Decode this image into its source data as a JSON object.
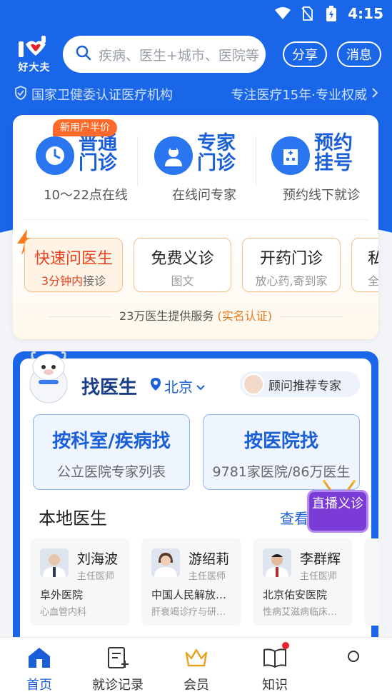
{
  "status": {
    "time": "4:15"
  },
  "header": {
    "logo_text": "好大夫",
    "search_placeholder": "疾病、医生+城市、医院等",
    "share_label": "分享",
    "message_label": "消息"
  },
  "cert": {
    "left": "国家卫健委认证医疗机构",
    "right": "专注医疗15年·专业权威"
  },
  "services": [
    {
      "name": "普通门诊",
      "sub": "10～22点在线",
      "badge": "新用户半价"
    },
    {
      "name": "专家门诊",
      "sub": "在线问专家"
    },
    {
      "name": "预约挂号",
      "sub": "预约线下就诊"
    }
  ],
  "quick": [
    {
      "title": "快速问医生",
      "sub_em": "3分钟内",
      "sub": "接诊"
    },
    {
      "title": "免费义诊",
      "sub": "图文"
    },
    {
      "title": "开药门诊",
      "sub": "放心药,寄到家"
    },
    {
      "title": "私",
      "sub": "全"
    }
  ],
  "footer_note": {
    "text": "23万医生提供服务",
    "highlight": "(实名认证)"
  },
  "find_doctor": {
    "title": "找医生",
    "city": "北京",
    "advisor": "顾问推荐专家",
    "by_dept": {
      "title": "按科室/疾病找",
      "sub": "公立医院专家列表"
    },
    "by_hosp": {
      "title": "按医院找",
      "sub": "9781家医院/86万医生"
    },
    "local_title": "本地医生",
    "more": "查看",
    "live": "直播义诊"
  },
  "doctors": [
    {
      "name": "刘海波",
      "title": "主任医师",
      "hospital": "阜外医院",
      "dept": "心血管内科"
    },
    {
      "name": "游绍莉",
      "title": "主任医师",
      "hospital": "中国人民解放…",
      "dept": "肝衰竭诊疗与研…"
    },
    {
      "name": "李群辉",
      "title": "主任医师",
      "hospital": "北京佑安医院",
      "dept": "性病艾滋病临床…"
    }
  ],
  "tabs": [
    {
      "label": "首页",
      "icon": "home-icon"
    },
    {
      "label": "就诊记录",
      "icon": "record-icon"
    },
    {
      "label": "会员",
      "icon": "crown-icon"
    },
    {
      "label": "知识",
      "icon": "book-icon"
    }
  ],
  "colors": {
    "primary": "#1a66e8",
    "accent": "#e8431f",
    "orange": "#ff6a2b"
  }
}
